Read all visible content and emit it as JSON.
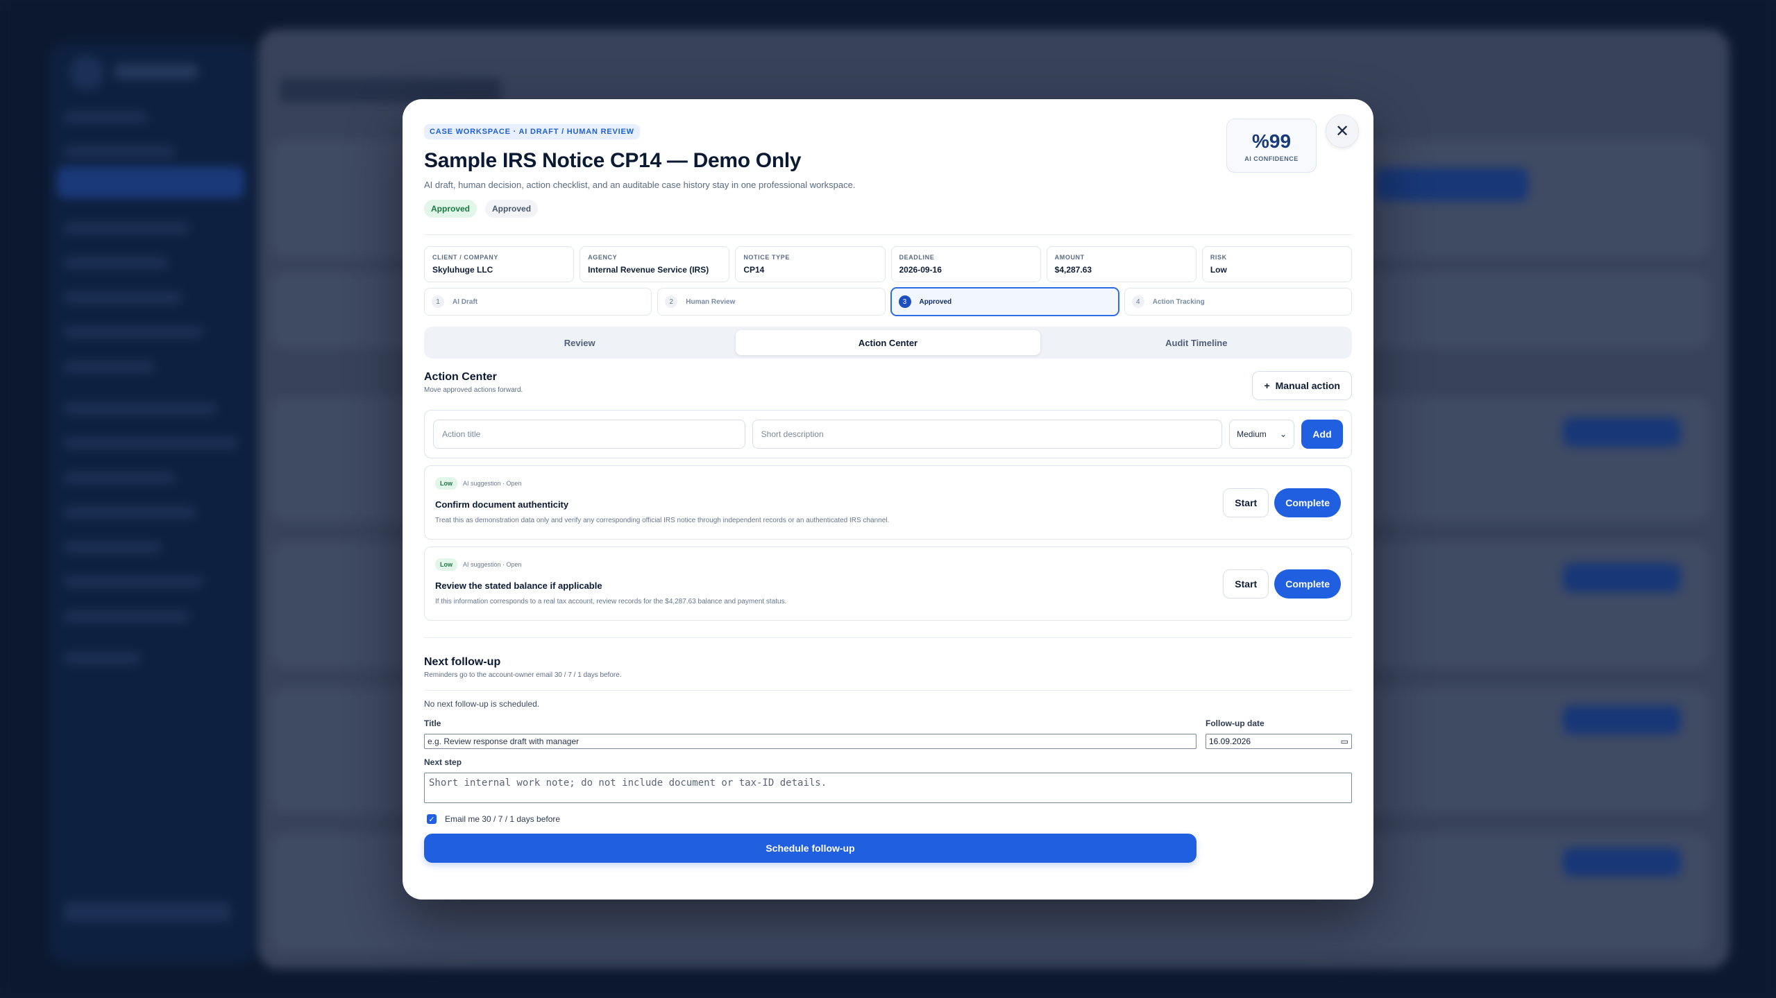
{
  "modal": {
    "eyebrow": "CASE WORKSPACE · AI DRAFT / HUMAN REVIEW",
    "title": "Sample IRS Notice CP14 — Demo Only",
    "description": "AI draft, human decision, action checklist, and an auditable case history stay in one professional workspace.",
    "badges": [
      "Approved",
      "Approved"
    ],
    "confidence": {
      "value": "%99",
      "label": "AI CONFIDENCE"
    },
    "close_icon": "close-icon"
  },
  "meta": [
    {
      "key": "CLIENT / COMPANY",
      "value": "Skyluhuge LLC"
    },
    {
      "key": "AGENCY",
      "value": "Internal Revenue Service (IRS)"
    },
    {
      "key": "NOTICE TYPE",
      "value": "CP14"
    },
    {
      "key": "DEADLINE",
      "value": "2026-09-16"
    },
    {
      "key": "AMOUNT",
      "value": "$4,287.63"
    },
    {
      "key": "RISK",
      "value": "Low"
    }
  ],
  "steps": [
    {
      "num": "1",
      "name": "AI Draft"
    },
    {
      "num": "2",
      "name": "Human Review"
    },
    {
      "num": "3",
      "name": "Approved"
    },
    {
      "num": "4",
      "name": "Action Tracking"
    }
  ],
  "tabs": [
    "Review",
    "Action Center",
    "Audit Timeline"
  ],
  "action_center": {
    "title": "Action Center",
    "subtitle": "Move approved actions forward.",
    "manual_button": "Manual action",
    "add_form": {
      "title_placeholder": "Action title",
      "desc_placeholder": "Short description",
      "priority": "Medium",
      "add_label": "Add"
    },
    "actions": [
      {
        "priority": "Low",
        "meta": "AI suggestion · Open",
        "title": "Confirm document authenticity",
        "description": "Treat this as demonstration data only and verify any corresponding official IRS notice through independent records or an authenticated IRS channel.",
        "start": "Start",
        "complete": "Complete"
      },
      {
        "priority": "Low",
        "meta": "AI suggestion · Open",
        "title": "Review the stated balance if applicable",
        "description": "If this information corresponds to a real tax account, review records for the $4,287.63 balance and payment status.",
        "start": "Start",
        "complete": "Complete"
      }
    ]
  },
  "followup": {
    "title": "Next follow-up",
    "subtitle": "Reminders go to the account-owner email 30 / 7 / 1 days before.",
    "note": "No next follow-up is scheduled.",
    "title_label": "Title",
    "title_placeholder": "e.g. Review response draft with manager",
    "date_label": "Follow-up date",
    "date_value": "16.09.2026",
    "next_step_label": "Next step",
    "next_step_placeholder": "Short internal work note; do not include document or tax-ID details.",
    "email_checkbox": "Email me 30 / 7 / 1 days before",
    "schedule_button": "Schedule follow-up"
  },
  "colors": {
    "accent": "#1f5fe0",
    "success_bg": "#e2f6e9",
    "success_text": "#1d7a44"
  }
}
